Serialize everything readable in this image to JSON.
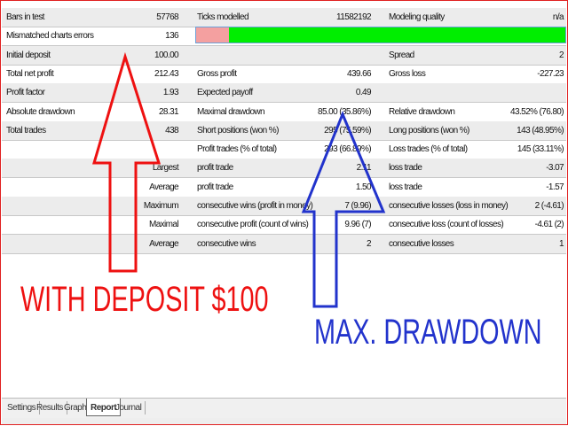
{
  "rows": [
    [
      "Bars in test",
      "57768",
      "Ticks modelled",
      "11582192",
      "Modeling quality",
      "n/a"
    ],
    [
      "Mismatched charts errors",
      "136",
      "",
      "",
      "",
      ""
    ],
    [
      "Initial deposit",
      "100.00",
      "",
      "",
      "Spread",
      "2"
    ],
    [
      "Total net profit",
      "212.43",
      "Gross profit",
      "439.66",
      "Gross loss",
      "-227.23"
    ],
    [
      "Profit factor",
      "1.93",
      "Expected payoff",
      "0.49",
      "",
      ""
    ],
    [
      "Absolute drawdown",
      "28.31",
      "Maximal drawdown",
      "85.00 (35.86%)",
      "Relative drawdown",
      "43.52% (76.80)"
    ],
    [
      "Total trades",
      "438",
      "Short positions (won %)",
      "295 (75.59%)",
      "Long positions (won %)",
      "143 (48.95%)"
    ],
    [
      "",
      "",
      "Profit trades (% of total)",
      "293 (66.89%)",
      "Loss trades (% of total)",
      "145 (33.11%)"
    ],
    [
      "",
      "Largest",
      "profit trade",
      "2.11",
      "loss trade",
      "-3.07"
    ],
    [
      "",
      "Average",
      "profit trade",
      "1.50",
      "loss trade",
      "-1.57"
    ],
    [
      "",
      "Maximum",
      "consecutive wins (profit in money)",
      "7 (9.96)",
      "consecutive losses (loss in money)",
      "2 (-4.61)"
    ],
    [
      "",
      "Maximal",
      "consecutive profit (count of wins)",
      "9.96 (7)",
      "consecutive loss (count of losses)",
      "-4.61 (2)"
    ],
    [
      "",
      "Average",
      "consecutive wins",
      "2",
      "consecutive losses",
      "1"
    ]
  ],
  "modeling_quality_bar": {
    "mismatch_fraction": 0.09,
    "colors": {
      "mismatch": "#f4a0a0",
      "good": "#00ee00"
    }
  },
  "annotations": {
    "deposit_text": "WITH DEPOSIT $100",
    "drawdown_text": "MAX. DRAWDOWN",
    "deposit_color": "#ee1111",
    "drawdown_color": "#2233cc"
  },
  "tabs": [
    "Settings",
    "Results",
    "Graph",
    "Report",
    "Journal"
  ],
  "active_tab": "Report"
}
